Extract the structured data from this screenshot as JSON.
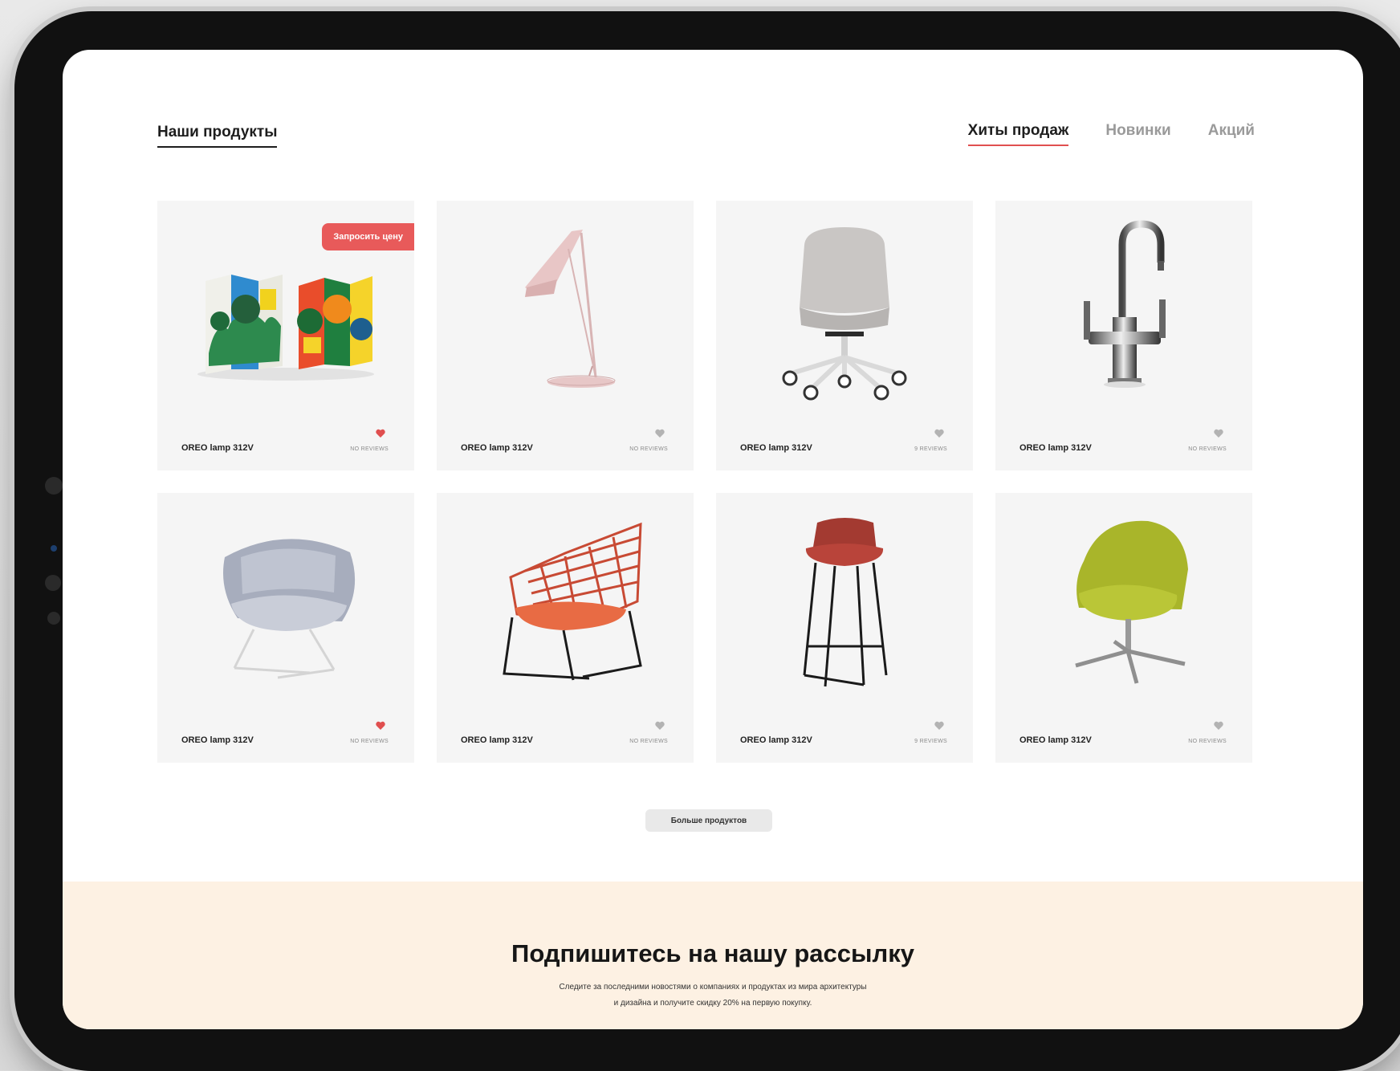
{
  "header": {
    "title": "Наши продукты",
    "tabs": [
      {
        "label": "Хиты продаж",
        "active": true
      },
      {
        "label": "Новинки",
        "active": false
      },
      {
        "label": "Акций",
        "active": false
      }
    ]
  },
  "products": [
    {
      "name": "OREO lamp 312V",
      "reviews": "NO REVIEWS",
      "favorite": true,
      "badge": "Запросить цену",
      "image": "folding-screen"
    },
    {
      "name": "OREO lamp 312V",
      "reviews": "NO REVIEWS",
      "favorite": false,
      "image": "desk-lamp"
    },
    {
      "name": "OREO lamp 312V",
      "reviews": "9 REVIEWS",
      "favorite": false,
      "image": "office-chair"
    },
    {
      "name": "OREO lamp 312V",
      "reviews": "NO REVIEWS",
      "favorite": false,
      "image": "faucet"
    },
    {
      "name": "OREO lamp 312V",
      "reviews": "NO REVIEWS",
      "favorite": true,
      "image": "lounge-chair-grey"
    },
    {
      "name": "OREO lamp 312V",
      "reviews": "NO REVIEWS",
      "favorite": false,
      "image": "wire-lounge-chair"
    },
    {
      "name": "OREO lamp 312V",
      "reviews": "9 REVIEWS",
      "favorite": false,
      "image": "bar-stool"
    },
    {
      "name": "OREO lamp 312V",
      "reviews": "NO REVIEWS",
      "favorite": false,
      "image": "swivel-chair-green"
    }
  ],
  "more_button": "Больше продуктов",
  "newsletter": {
    "title": "Подпишитесь на нашу рассылку",
    "text_line1": "Следите за последними новостями о компаниях и продуктах из мира архитектуры",
    "text_line2": "и дизайна и получите скидку 20% на первую покупку."
  },
  "colors": {
    "accent": "#e04f4f",
    "heart_active": "#e04f4f",
    "heart_inactive": "#b3b3b3",
    "newsletter_bg": "#fdf1e3"
  }
}
